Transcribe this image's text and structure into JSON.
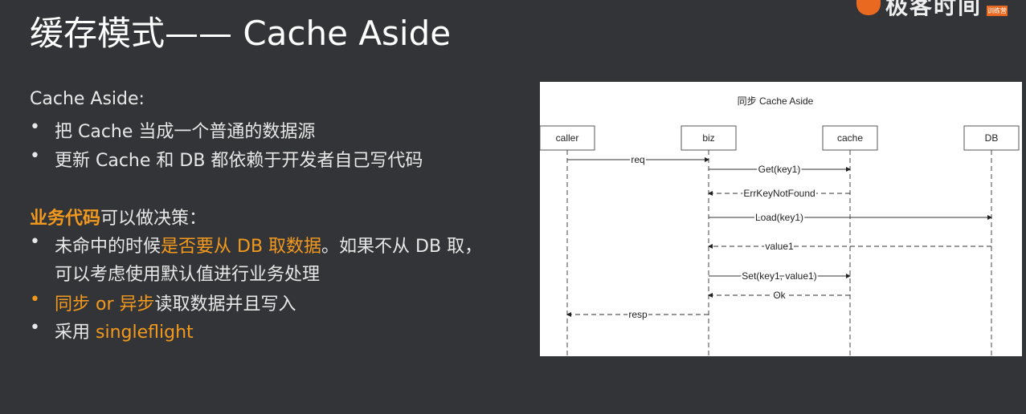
{
  "title": "缓存模式—— Cache Aside",
  "logo": {
    "text": "极客时间",
    "badge": "训练营"
  },
  "content": {
    "heading": "Cache Aside:",
    "bullets1": [
      "把 Cache 当成一个普通的数据源",
      "更新 Cache 和 DB 都依赖于开发者自己写代码"
    ],
    "decision_bold": "业务代码",
    "decision_rest": "可以做决策：",
    "b3_pre": "未命中的时候",
    "b3_hl": "是否要从 DB 取数据",
    "b3_post": "。如果不从 DB 取，",
    "b3_cont": "可以考虑使用默认值进行业务处理",
    "b4_hl": "同步 or 异步",
    "b4_post": "读取数据并且写入",
    "b5_pre": "采用 ",
    "b5_hl": "singleflight"
  },
  "diagram": {
    "title": "同步 Cache Aside",
    "participants": [
      "caller",
      "biz",
      "cache",
      "DB"
    ],
    "messages": [
      {
        "from": 0,
        "to": 1,
        "label": "req",
        "dashed": false
      },
      {
        "from": 1,
        "to": 2,
        "label": "Get(key1)",
        "dashed": false
      },
      {
        "from": 2,
        "to": 1,
        "label": "ErrKeyNotFound",
        "dashed": true
      },
      {
        "from": 1,
        "to": 3,
        "label": "Load(key1)",
        "dashed": false
      },
      {
        "from": 3,
        "to": 1,
        "label": "value1",
        "dashed": true
      },
      {
        "from": 1,
        "to": 2,
        "label": "Set(key1, value1)",
        "dashed": false
      },
      {
        "from": 2,
        "to": 1,
        "label": "Ok",
        "dashed": true
      },
      {
        "from": 1,
        "to": 0,
        "label": "resp",
        "dashed": true
      }
    ]
  }
}
